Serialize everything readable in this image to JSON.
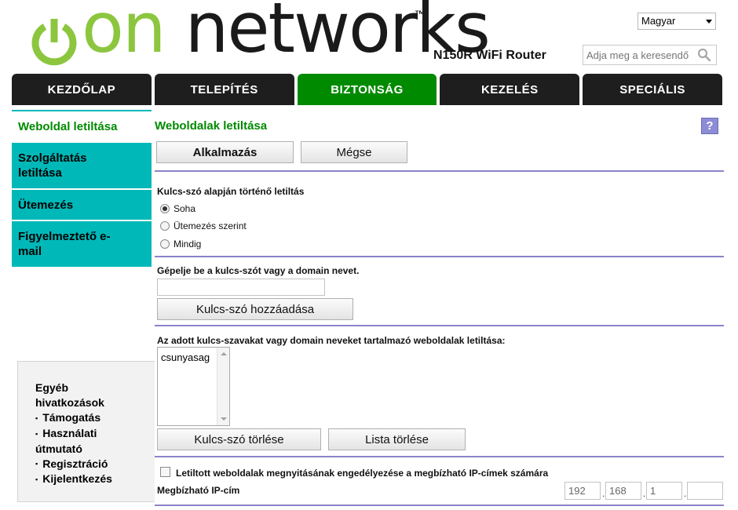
{
  "header": {
    "logo_prefix": "on",
    "logo_text": " networks",
    "logo_tm": "™",
    "product_name": "N150R WiFi Router",
    "language": "Magyar",
    "search_placeholder": "Adja meg a keresendő"
  },
  "nav": {
    "tabs": [
      {
        "label": "KEZDŐLAP",
        "active": false
      },
      {
        "label": "TELEPÍTÉS",
        "active": false
      },
      {
        "label": "BIZTONSÁG",
        "active": true
      },
      {
        "label": "KEZELÉS",
        "active": false
      },
      {
        "label": "SPECIÁLIS",
        "active": false
      }
    ]
  },
  "sidebar": {
    "items": [
      {
        "label": "Weboldal letiltása",
        "active": true
      },
      {
        "label": "Szolgáltatás letiltása",
        "active": false
      },
      {
        "label": "Ütemezés",
        "active": false
      },
      {
        "label": "Figyelmeztető e-mail",
        "active": false
      }
    ]
  },
  "other_links": {
    "title": "Egyéb hivatkozások",
    "links": [
      "Támogatás",
      "Használati útmutató",
      "Regisztráció",
      "Kijelentkezés"
    ]
  },
  "main": {
    "title": "Weboldalak letiltása",
    "help_label": "?",
    "apply_label": "Alkalmazás",
    "cancel_label": "Mégse",
    "keyword_blocking_label": "Kulcs-szó alapján történő letiltás",
    "radio_options": [
      {
        "label": "Soha",
        "checked": true
      },
      {
        "label": "Ütemezés szerint",
        "checked": false
      },
      {
        "label": "Mindig",
        "checked": false
      }
    ],
    "keyword_prompt": "Gépelje be a kulcs-szót vagy a domain nevet.",
    "keyword_value": "",
    "add_keyword_label": "Kulcs-szó hozzáadása",
    "blocked_list_label": "Az adott kulcs-szavakat vagy domain neveket tartalmazó weboldalak letiltása:",
    "blocked_keywords": [
      "csunyasag"
    ],
    "delete_keyword_label": "Kulcs-szó törlése",
    "clear_list_label": "Lista törlése",
    "trusted_ip_allow_label": "Letiltott weboldalak megnyitásának engedélyezése a megbízható IP-címek számára",
    "trusted_ip_allow_checked": false,
    "trusted_ip_label": "Megbízható IP-cím",
    "trusted_ip": [
      "192",
      "168",
      "1",
      ""
    ]
  },
  "colors": {
    "accent_green": "#008a00",
    "nav_dark": "#1e1e1e",
    "sidebar_teal": "#00b8b8",
    "separator": "#8a84c8",
    "logo_green": "#8cc63f"
  }
}
